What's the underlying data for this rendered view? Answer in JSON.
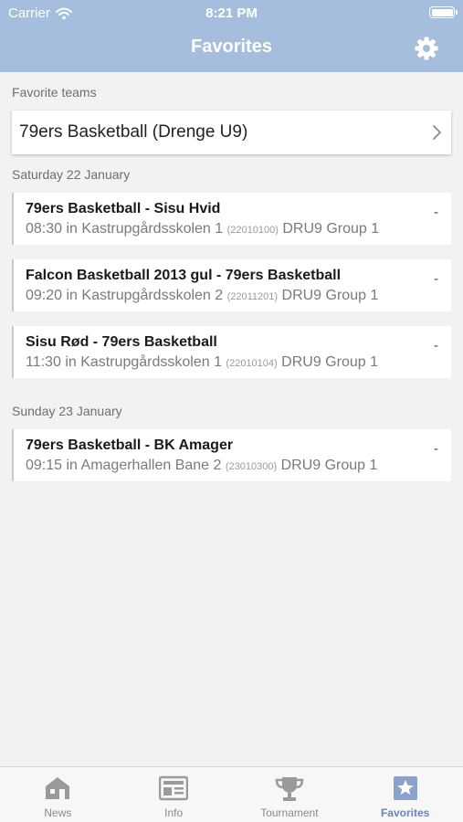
{
  "status_bar": {
    "carrier": "Carrier",
    "time": "8:21 PM"
  },
  "nav": {
    "title": "Favorites"
  },
  "favorite_teams": {
    "label": "Favorite teams",
    "teams": [
      {
        "name": "79ers Basketball (Drenge U9)"
      }
    ]
  },
  "days": [
    {
      "label": "Saturday 22 January",
      "matches": [
        {
          "title": "79ers Basketball - Sisu Hvid",
          "time": "08:30",
          "venue": "in Kastrupgårdsskolen 1",
          "code": "(22010100)",
          "group": "DRU9 Group 1",
          "score": "-"
        },
        {
          "title": "Falcon Basketball 2013 gul - 79ers Basketball",
          "time": "09:20",
          "venue": "in Kastrupgårdsskolen 2",
          "code": "(22011201)",
          "group": "DRU9 Group 1",
          "score": "-"
        },
        {
          "title": "Sisu Rød - 79ers Basketball",
          "time": "11:30",
          "venue": "in Kastrupgårdsskolen 1",
          "code": "(22010104)",
          "group": "DRU9 Group 1",
          "score": "-"
        }
      ]
    },
    {
      "label": "Sunday 23 January",
      "matches": [
        {
          "title": "79ers Basketball - BK Amager",
          "time": "09:15",
          "venue": "in Amagerhallen Bane 2",
          "code": "(23010300)",
          "group": "DRU9 Group 1",
          "score": "-"
        }
      ]
    }
  ],
  "tabbar": {
    "tabs": [
      {
        "label": "News",
        "icon": "house-icon"
      },
      {
        "label": "Info",
        "icon": "newspaper-icon"
      },
      {
        "label": "Tournament",
        "icon": "trophy-icon"
      },
      {
        "label": "Favorites",
        "icon": "star-icon",
        "active": true
      }
    ]
  },
  "colors": {
    "nav_bg": "#a6bedd",
    "accent": "#6a84b2",
    "background": "#f2f2f2"
  }
}
